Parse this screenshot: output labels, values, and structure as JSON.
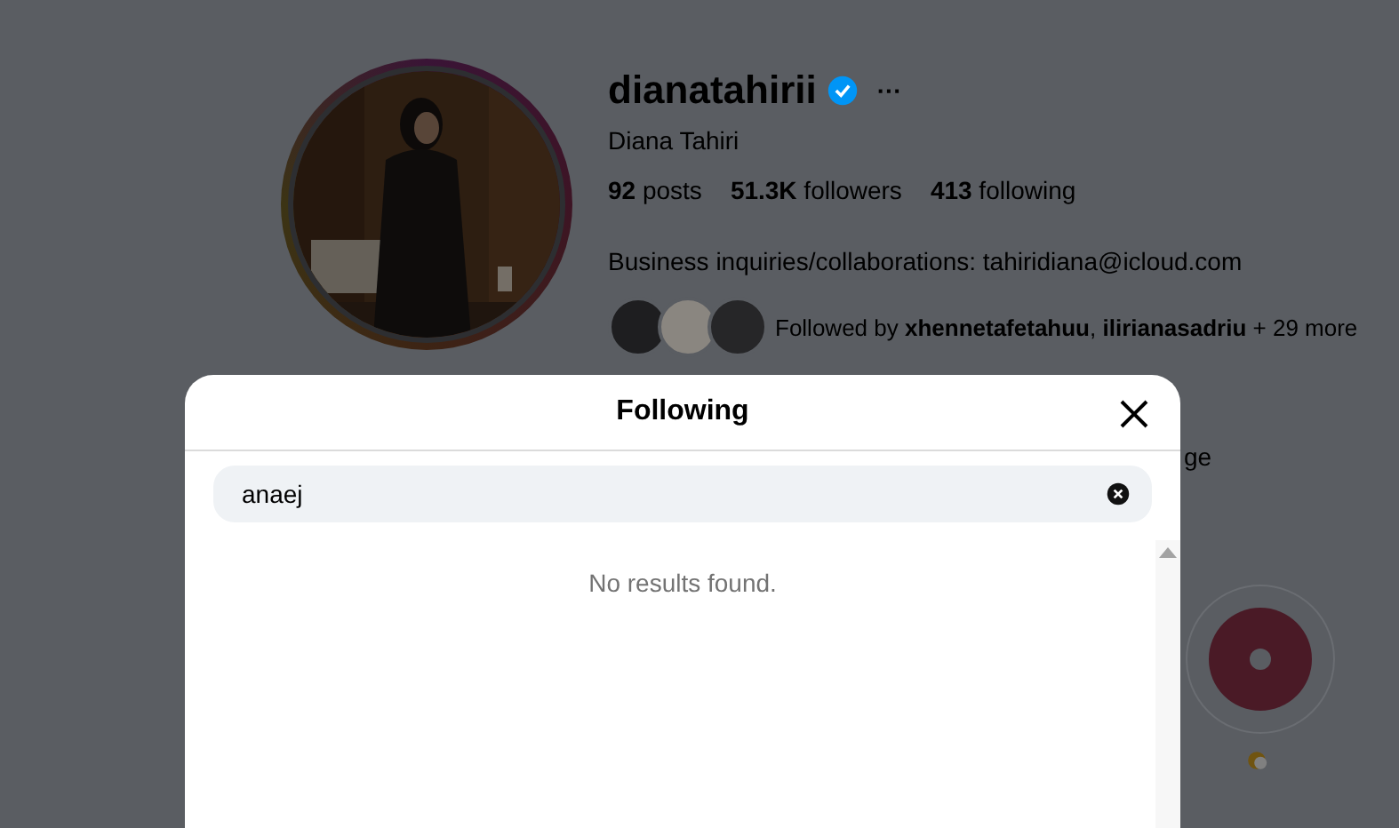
{
  "profile": {
    "username": "dianatahirii",
    "verified": true,
    "more": "···",
    "full_name": "Diana Tahiri",
    "stats": [
      {
        "count": "92",
        "label": "posts"
      },
      {
        "count": "51.3K",
        "label": "followers"
      },
      {
        "count": "413",
        "label": "following"
      }
    ],
    "bio": "Business inquiries/collaborations: tahiridiana@icloud.com",
    "followed_by": "Followed by **xhennetafetahuu**, **ilirianasadriu** + 29 more",
    "bio_fragment": "ge"
  },
  "modal": {
    "title": "Following",
    "search": {
      "value": "anaej"
    },
    "empty_message": "No results found."
  }
}
